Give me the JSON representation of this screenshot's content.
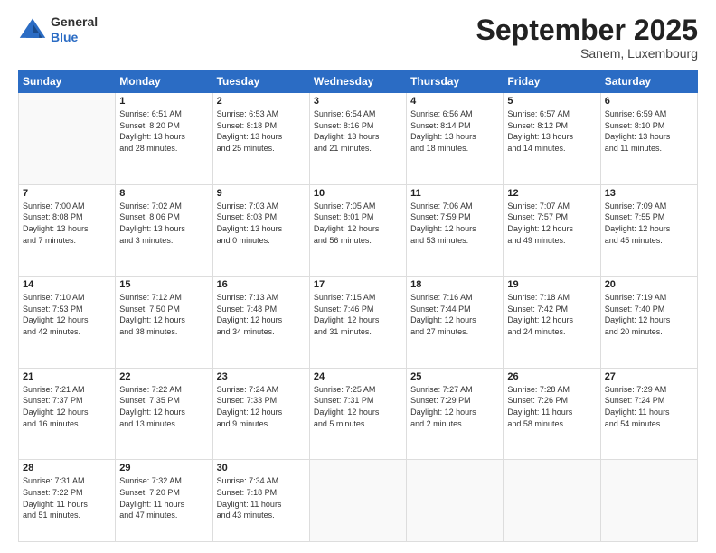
{
  "logo": {
    "general": "General",
    "blue": "Blue"
  },
  "header": {
    "title": "September 2025",
    "subtitle": "Sanem, Luxembourg"
  },
  "weekdays": [
    "Sunday",
    "Monday",
    "Tuesday",
    "Wednesday",
    "Thursday",
    "Friday",
    "Saturday"
  ],
  "weeks": [
    [
      {
        "day": "",
        "info": ""
      },
      {
        "day": "1",
        "info": "Sunrise: 6:51 AM\nSunset: 8:20 PM\nDaylight: 13 hours\nand 28 minutes."
      },
      {
        "day": "2",
        "info": "Sunrise: 6:53 AM\nSunset: 8:18 PM\nDaylight: 13 hours\nand 25 minutes."
      },
      {
        "day": "3",
        "info": "Sunrise: 6:54 AM\nSunset: 8:16 PM\nDaylight: 13 hours\nand 21 minutes."
      },
      {
        "day": "4",
        "info": "Sunrise: 6:56 AM\nSunset: 8:14 PM\nDaylight: 13 hours\nand 18 minutes."
      },
      {
        "day": "5",
        "info": "Sunrise: 6:57 AM\nSunset: 8:12 PM\nDaylight: 13 hours\nand 14 minutes."
      },
      {
        "day": "6",
        "info": "Sunrise: 6:59 AM\nSunset: 8:10 PM\nDaylight: 13 hours\nand 11 minutes."
      }
    ],
    [
      {
        "day": "7",
        "info": "Sunrise: 7:00 AM\nSunset: 8:08 PM\nDaylight: 13 hours\nand 7 minutes."
      },
      {
        "day": "8",
        "info": "Sunrise: 7:02 AM\nSunset: 8:06 PM\nDaylight: 13 hours\nand 3 minutes."
      },
      {
        "day": "9",
        "info": "Sunrise: 7:03 AM\nSunset: 8:03 PM\nDaylight: 13 hours\nand 0 minutes."
      },
      {
        "day": "10",
        "info": "Sunrise: 7:05 AM\nSunset: 8:01 PM\nDaylight: 12 hours\nand 56 minutes."
      },
      {
        "day": "11",
        "info": "Sunrise: 7:06 AM\nSunset: 7:59 PM\nDaylight: 12 hours\nand 53 minutes."
      },
      {
        "day": "12",
        "info": "Sunrise: 7:07 AM\nSunset: 7:57 PM\nDaylight: 12 hours\nand 49 minutes."
      },
      {
        "day": "13",
        "info": "Sunrise: 7:09 AM\nSunset: 7:55 PM\nDaylight: 12 hours\nand 45 minutes."
      }
    ],
    [
      {
        "day": "14",
        "info": "Sunrise: 7:10 AM\nSunset: 7:53 PM\nDaylight: 12 hours\nand 42 minutes."
      },
      {
        "day": "15",
        "info": "Sunrise: 7:12 AM\nSunset: 7:50 PM\nDaylight: 12 hours\nand 38 minutes."
      },
      {
        "day": "16",
        "info": "Sunrise: 7:13 AM\nSunset: 7:48 PM\nDaylight: 12 hours\nand 34 minutes."
      },
      {
        "day": "17",
        "info": "Sunrise: 7:15 AM\nSunset: 7:46 PM\nDaylight: 12 hours\nand 31 minutes."
      },
      {
        "day": "18",
        "info": "Sunrise: 7:16 AM\nSunset: 7:44 PM\nDaylight: 12 hours\nand 27 minutes."
      },
      {
        "day": "19",
        "info": "Sunrise: 7:18 AM\nSunset: 7:42 PM\nDaylight: 12 hours\nand 24 minutes."
      },
      {
        "day": "20",
        "info": "Sunrise: 7:19 AM\nSunset: 7:40 PM\nDaylight: 12 hours\nand 20 minutes."
      }
    ],
    [
      {
        "day": "21",
        "info": "Sunrise: 7:21 AM\nSunset: 7:37 PM\nDaylight: 12 hours\nand 16 minutes."
      },
      {
        "day": "22",
        "info": "Sunrise: 7:22 AM\nSunset: 7:35 PM\nDaylight: 12 hours\nand 13 minutes."
      },
      {
        "day": "23",
        "info": "Sunrise: 7:24 AM\nSunset: 7:33 PM\nDaylight: 12 hours\nand 9 minutes."
      },
      {
        "day": "24",
        "info": "Sunrise: 7:25 AM\nSunset: 7:31 PM\nDaylight: 12 hours\nand 5 minutes."
      },
      {
        "day": "25",
        "info": "Sunrise: 7:27 AM\nSunset: 7:29 PM\nDaylight: 12 hours\nand 2 minutes."
      },
      {
        "day": "26",
        "info": "Sunrise: 7:28 AM\nSunset: 7:26 PM\nDaylight: 11 hours\nand 58 minutes."
      },
      {
        "day": "27",
        "info": "Sunrise: 7:29 AM\nSunset: 7:24 PM\nDaylight: 11 hours\nand 54 minutes."
      }
    ],
    [
      {
        "day": "28",
        "info": "Sunrise: 7:31 AM\nSunset: 7:22 PM\nDaylight: 11 hours\nand 51 minutes."
      },
      {
        "day": "29",
        "info": "Sunrise: 7:32 AM\nSunset: 7:20 PM\nDaylight: 11 hours\nand 47 minutes."
      },
      {
        "day": "30",
        "info": "Sunrise: 7:34 AM\nSunset: 7:18 PM\nDaylight: 11 hours\nand 43 minutes."
      },
      {
        "day": "",
        "info": ""
      },
      {
        "day": "",
        "info": ""
      },
      {
        "day": "",
        "info": ""
      },
      {
        "day": "",
        "info": ""
      }
    ]
  ]
}
